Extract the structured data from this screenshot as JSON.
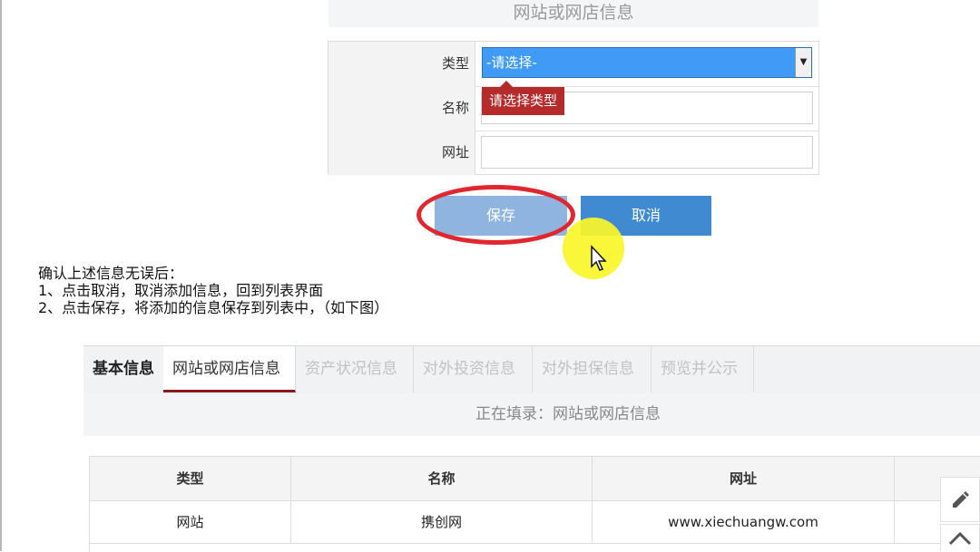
{
  "form": {
    "section_title": "网站或网店信息",
    "type_label": "类型",
    "type_select_value": "-请选择-",
    "validation_message": "请选择类型",
    "name_label": "名称",
    "name_value": "",
    "url_label": "网址",
    "url_value": ""
  },
  "buttons": {
    "save_label": "保存",
    "cancel_label": "取消"
  },
  "instructions": {
    "line1": "确认上述信息无误后：",
    "line2": "1、点击取消，取消添加信息，回到列表界面",
    "line3": "2、点击保存，将添加的信息保存到列表中，（如下图）"
  },
  "tabs": [
    {
      "label": "基本信息",
      "state": "done"
    },
    {
      "label": "网站或网店信息",
      "state": "active"
    },
    {
      "label": "资产状况信息",
      "state": "disabled"
    },
    {
      "label": "对外投资信息",
      "state": "disabled"
    },
    {
      "label": "对外担保信息",
      "state": "disabled"
    },
    {
      "label": "预览并公示",
      "state": "disabled"
    }
  ],
  "filling_status": "正在填录：网站或网店信息",
  "list_table": {
    "headers": [
      "类型",
      "名称",
      "网址"
    ],
    "rows": [
      [
        "网站",
        "携创网",
        "www.xiechuangw.com"
      ]
    ]
  },
  "colors": {
    "select_highlight": "#3f9bf5",
    "error_red": "#b52b2b",
    "annotation_ring": "#e0262f",
    "button_blue": "#3f8ad0",
    "tab_active_underline": "#8b1a1a"
  }
}
